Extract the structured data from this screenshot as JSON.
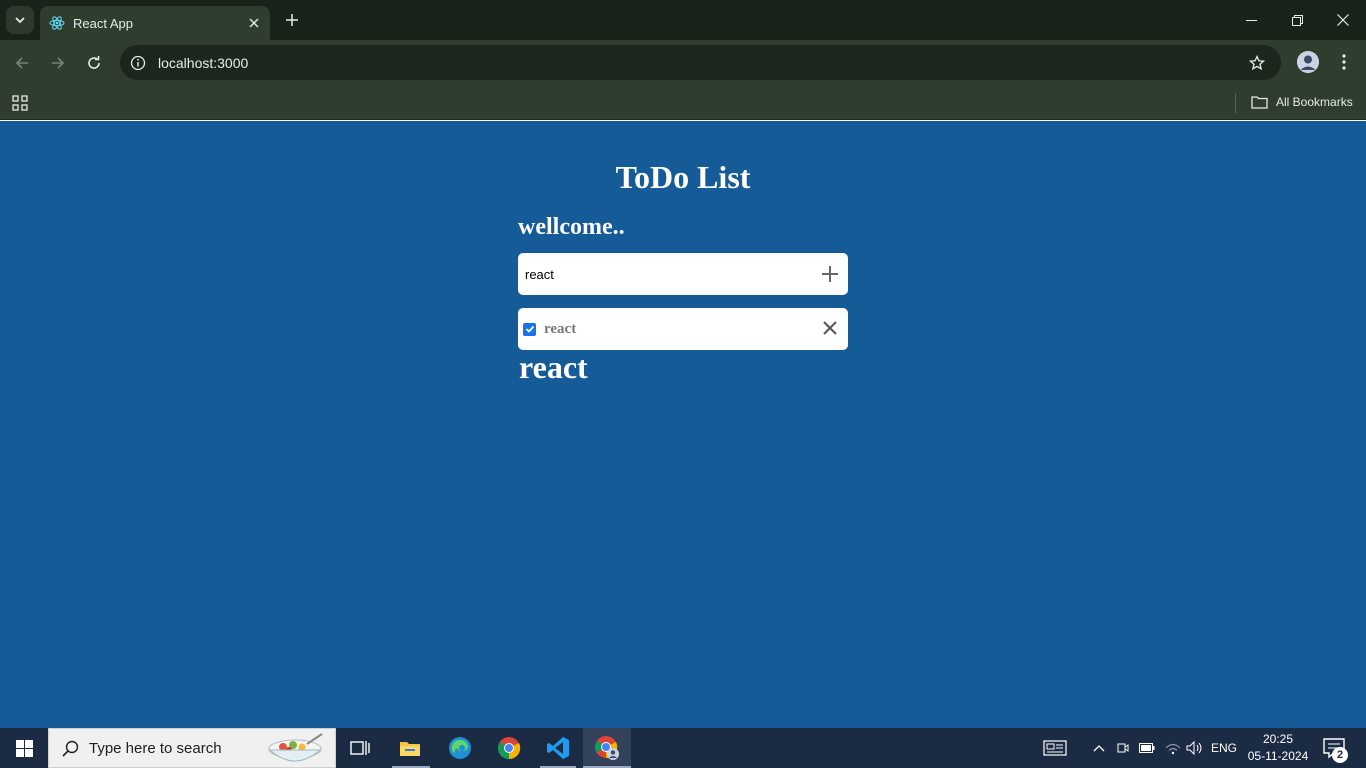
{
  "browser": {
    "tab": {
      "title": "React App"
    },
    "address_bar": {
      "url": "localhost:3000"
    },
    "bookmarks_bar": {
      "all_bookmarks_label": "All Bookmarks"
    }
  },
  "app": {
    "title": "ToDo List",
    "greeting": "wellcome..",
    "input": {
      "value": "react",
      "placeholder": ""
    },
    "todos": [
      {
        "text": "react",
        "checked": true
      }
    ],
    "display_text": "react"
  },
  "taskbar": {
    "search_placeholder": "Type here to search",
    "language": "ENG",
    "time": "20:25",
    "date": "05-11-2024",
    "notification_count": "2",
    "pinned_apps": [
      "task-view-icon",
      "file-explorer-icon",
      "edge-icon",
      "chrome-icon",
      "vscode-icon",
      "chrome-profile-icon"
    ]
  },
  "colors": {
    "page_background": "#155b98",
    "browser_frame": "#2f3d2f",
    "checkbox_accent": "#1a73e8"
  }
}
